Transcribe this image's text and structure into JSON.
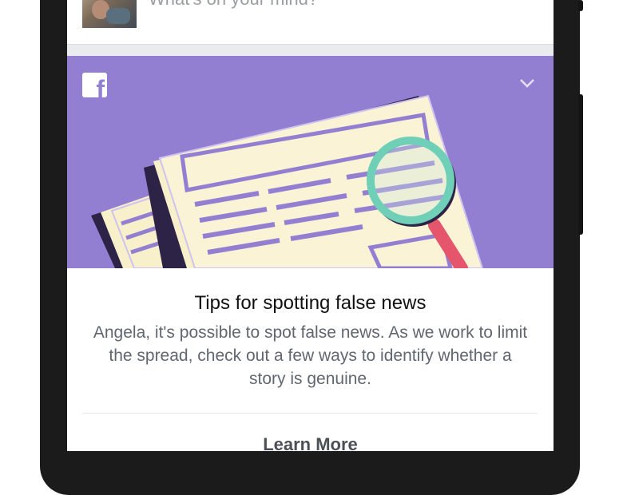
{
  "composer": {
    "placeholder": "What's on your mind?"
  },
  "card": {
    "title": "Tips for spotting false news",
    "body": "Angela, it's possible to spot false news. As we work to limit the spread, check out a few ways to identify whether a story is genuine.",
    "cta_label": "Learn More",
    "banner_color": "#937fd1",
    "logo_glyph": "f"
  },
  "icons": {
    "logo": "facebook-logo-icon",
    "collapse": "chevron-down-icon",
    "illustration": "newspaper-magnifier-illustration"
  }
}
